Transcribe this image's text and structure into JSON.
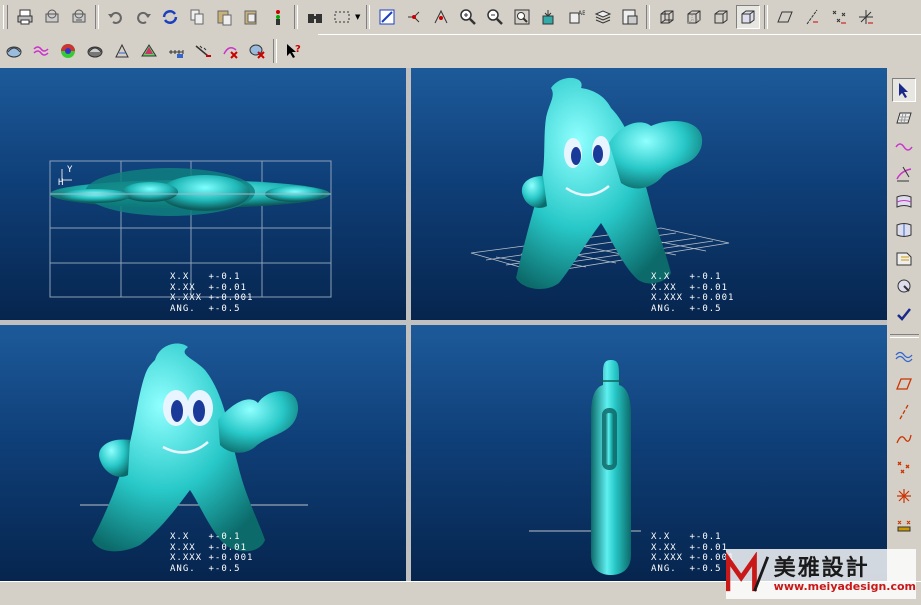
{
  "toolbar_top": {
    "groups": [
      [
        "print-icon",
        "print-preview-icon",
        "quick-print-icon"
      ],
      [
        "undo-icon",
        "redo-icon",
        "regenerate-icon",
        "copy-icon",
        "paste-icon",
        "paste-special-icon",
        "model-tree-icon"
      ],
      [
        "find-icon",
        "selection-box-icon"
      ],
      [
        "repaint-icon",
        "spin-center-icon",
        "orient-icon",
        "zoom-in-icon",
        "zoom-out-icon",
        "refit-icon",
        "saved-views-icon",
        "view-manager-icon",
        "layers-icon",
        "model-display-icon"
      ],
      [
        "wireframe-icon",
        "hidden-line-icon",
        "no-hidden-icon",
        "shading-icon"
      ],
      [
        "datum-planes-icon",
        "datum-axes-icon",
        "datum-points-icon",
        "coordinate-systems-icon"
      ]
    ]
  },
  "toolbar_second": {
    "icons": [
      "curve-analysis-icon",
      "surface-curvature-icon",
      "shade-curvature-icon",
      "draft-check-icon",
      "section-analysis-icon",
      "reflection-icon",
      "offset-analysis-icon",
      "deviation-icon",
      "delete-analysis-icon",
      "delete-all-analyses-icon",
      "context-help-icon"
    ]
  },
  "viewports": {
    "tolerance": {
      "line1": "X.X   +-0.1",
      "line2": "X.XX  +-0.01",
      "line3": "X.XXX +-0.001",
      "line4": "ANG.  +-0.5"
    },
    "tol_top_left": {
      "line1": "X.X   +-0.1",
      "line2": "X.XX  +-0.01",
      "line3": "X.XXX +-0.001",
      "line4": "ANG.  +-0.5"
    },
    "axis_labels": {
      "y": "Y",
      "h": "H"
    },
    "colors": {
      "model": "#2fc8c8",
      "background_top": "#1d5a9a",
      "background_bottom": "#06254e"
    }
  },
  "right_toolbar": {
    "icons": [
      "select-arrow-icon",
      "sketch-plane-icon",
      "create-curve-icon",
      "drop-curve-icon",
      "create-surface-icon",
      "connect-surface-icon",
      "trim-surface-icon",
      "delete-surface-icon",
      "done-checkmark-icon",
      "curve-network-icon",
      "datum-plane-icon",
      "datum-axis-icon",
      "datum-curve-icon",
      "datum-point-icon",
      "point-offset-icon",
      "coordinate-system-icon"
    ]
  },
  "watermark": {
    "name_cn": "美雅設計",
    "url": "www.meiyadesign.com"
  }
}
